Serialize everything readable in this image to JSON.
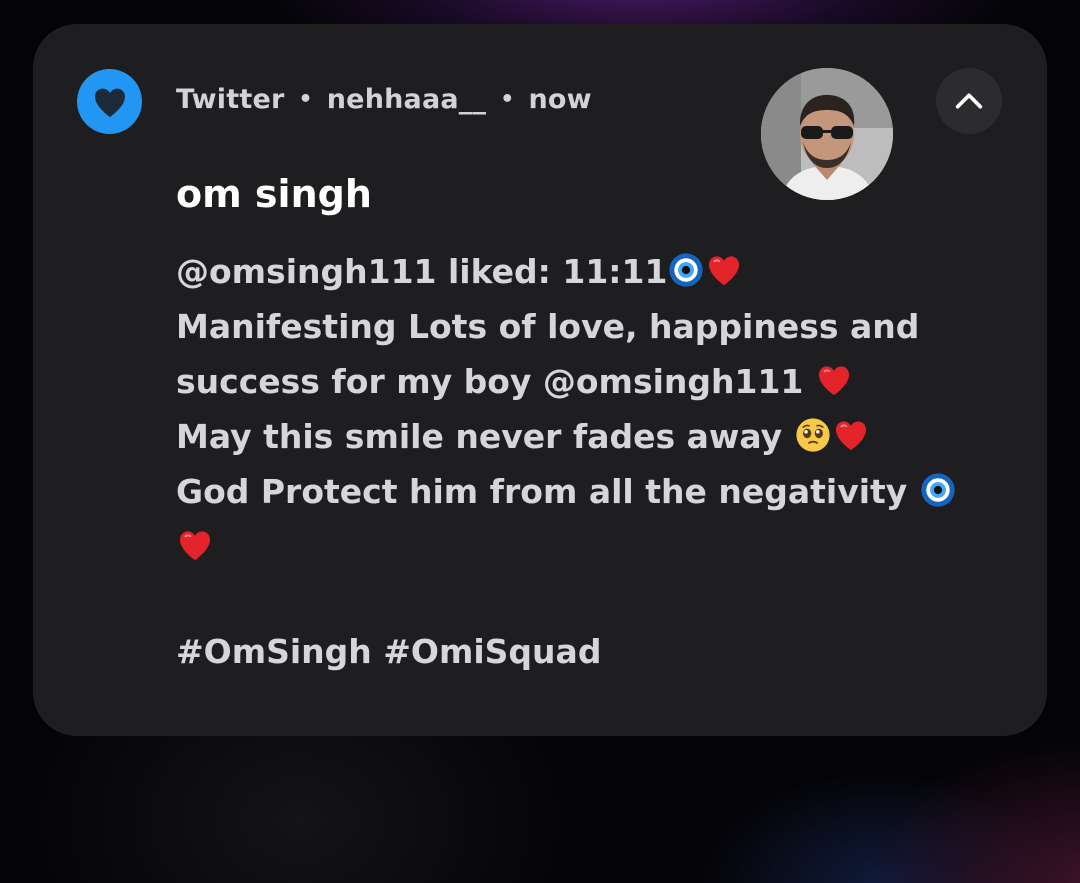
{
  "notification": {
    "app_name": "Twitter",
    "account": "nehhaaa__",
    "time": "now",
    "separator": "•",
    "title": "om singh",
    "body_lines": [
      {
        "text": "@omsingh111 liked: 11:11",
        "emoji": [
          "nazar-amulet-emoji",
          "red-heart-emoji"
        ]
      },
      {
        "text": "Manifesting Lots of love, happiness and",
        "emoji": []
      },
      {
        "text": "success for my boy @omsingh111 ",
        "emoji": [
          "red-heart-emoji"
        ]
      },
      {
        "text": "May this smile never fades away ",
        "emoji": [
          "pleading-face-emoji",
          "red-heart-emoji"
        ]
      },
      {
        "text": "God Protect him from all the negativity ",
        "emoji": [
          "nazar-amulet-emoji"
        ]
      },
      {
        "text": "",
        "emoji": [
          "red-heart-emoji"
        ]
      }
    ],
    "hashtags": "#OmSingh #OmiSquad",
    "icons": {
      "app": "heart-icon",
      "collapse": "chevron-up-icon",
      "avatar": "profile-photo"
    },
    "colors": {
      "card_background": "#1e1e20",
      "app_icon_background": "#2196f3",
      "text": "#d6d6d9",
      "title": "#ffffff"
    }
  }
}
